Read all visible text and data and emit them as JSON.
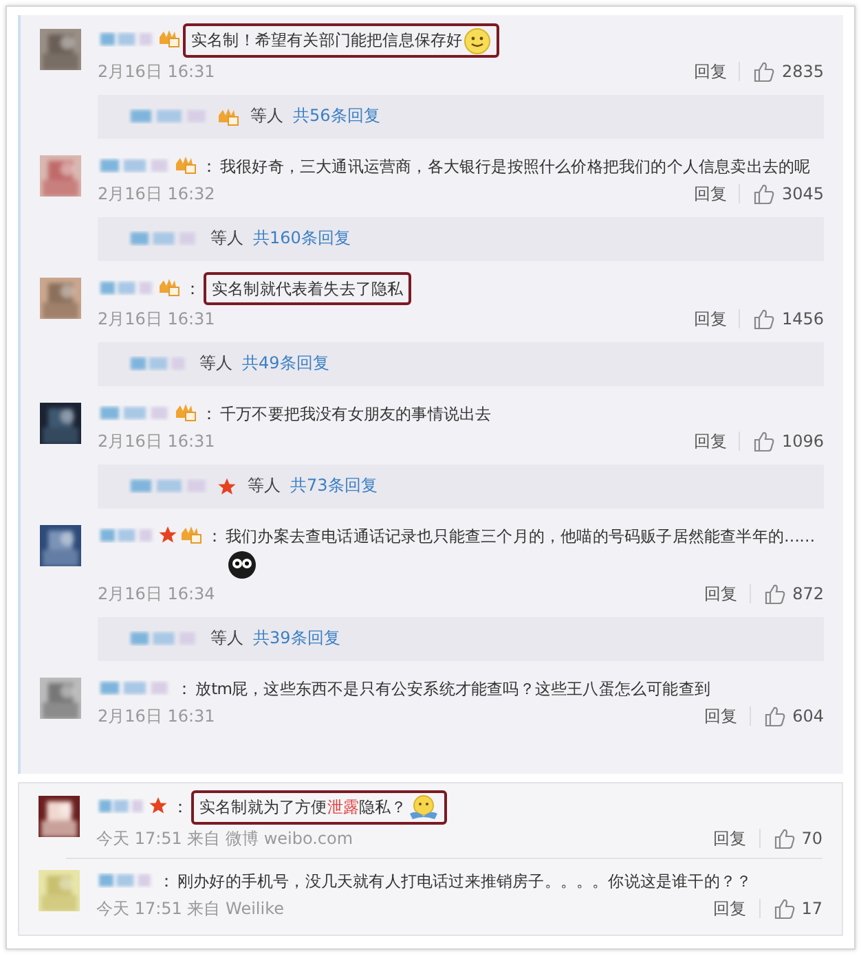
{
  "thread": {
    "comments": [
      {
        "badges": [
          {
            "kind": "crown"
          }
        ],
        "text_parts": [
          {
            "text": "实名制！希望有关部门能把信息保存好"
          }
        ],
        "highlighted": true,
        "emoji": {
          "kind": "smile"
        },
        "time": "2月16日 16:31",
        "reply": "回复",
        "likes": "2835",
        "replies": {
          "badges": [
            {
              "kind": "crown"
            }
          ],
          "suffix": "等人",
          "link": "共56条回复"
        }
      },
      {
        "badges": [
          {
            "kind": "crown"
          }
        ],
        "colon": "：",
        "text_parts": [
          {
            "text": "我很好奇，三大通讯运营商，各大银行是按照什么价格把我们的个人信息卖出去的呢"
          }
        ],
        "highlighted": false,
        "time": "2月16日 16:32",
        "reply": "回复",
        "likes": "3045",
        "replies": {
          "suffix": "等人",
          "link": "共160条回复"
        }
      },
      {
        "badges": [
          {
            "kind": "crown"
          }
        ],
        "colon": "：",
        "text_parts": [
          {
            "text": "实名制就代表着失去了隐私"
          }
        ],
        "highlighted": true,
        "time": "2月16日 16:31",
        "reply": "回复",
        "likes": "1456",
        "replies": {
          "suffix": "等人",
          "link": "共49条回复"
        }
      },
      {
        "badges": [
          {
            "kind": "crown"
          }
        ],
        "colon": "：",
        "text_parts": [
          {
            "text": "千万不要把我没有女朋友的事情说出去"
          }
        ],
        "highlighted": false,
        "time": "2月16日 16:31",
        "reply": "回复",
        "likes": "1096",
        "replies": {
          "badges": [
            {
              "kind": "star"
            }
          ],
          "suffix": "等人",
          "link": "共73条回复"
        }
      },
      {
        "badges": [
          {
            "kind": "star"
          },
          {
            "kind": "crown"
          }
        ],
        "colon": "：",
        "text_parts": [
          {
            "text": "我们办案去查电话通话记录也只能查三个月的，他喵的号码贩子居然能查半年的……"
          }
        ],
        "highlighted": false,
        "emoji": {
          "kind": "eyes"
        },
        "time": "2月16日 16:34",
        "reply": "回复",
        "likes": "872",
        "replies": {
          "suffix": "等人",
          "link": "共39条回复"
        }
      },
      {
        "colon": "：",
        "text_parts": [
          {
            "text": "放tm屁，这些东西不是只有公安系统才能查吗？这些王八蛋怎么可能查到"
          }
        ],
        "highlighted": false,
        "time": "2月16日 16:31",
        "reply": "回复",
        "likes": "604"
      }
    ]
  },
  "feed": {
    "comments": [
      {
        "badges": [
          {
            "kind": "star"
          }
        ],
        "colon": "：",
        "text_parts": [
          {
            "text": "实名制就为了方便"
          },
          {
            "text": "泄露",
            "highlight": true
          },
          {
            "text": "隐私？"
          }
        ],
        "highlighted": true,
        "emoji": {
          "kind": "hug"
        },
        "time": "今天 17:51 来自 微博 weibo.com",
        "reply": "回复",
        "likes": "70"
      },
      {
        "colon": "：",
        "text_parts": [
          {
            "text": "刚办好的手机号，没几天就有人打电话过来推销房子。。。。你说这是谁干的？？"
          }
        ],
        "highlighted": false,
        "time": "今天 17:51 来自 Weilike",
        "reply": "回复",
        "likes": "17"
      }
    ]
  }
}
